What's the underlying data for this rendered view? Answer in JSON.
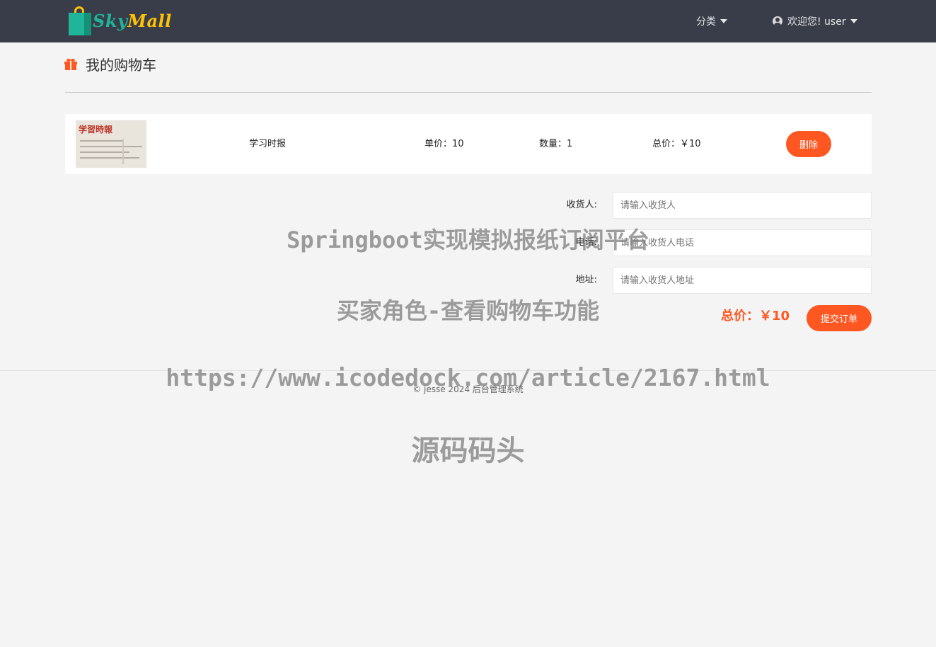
{
  "header": {
    "logo": {
      "part1": "Sky",
      "part2": "Mall"
    },
    "category_menu": "分类",
    "user_menu": "欢迎您! user"
  },
  "page": {
    "title": "我的购物车"
  },
  "cart": {
    "items": [
      {
        "name": "学习时报",
        "unit_price": "单价：10",
        "quantity": "数量：1",
        "total": "总价：￥10",
        "delete_label": "删除",
        "thumb_title": "学習時報"
      }
    ]
  },
  "form": {
    "receiver_label": "收货人:",
    "receiver_placeholder": "请输入收货人",
    "phone_label": "电话:",
    "phone_placeholder": "请输入收货人电话",
    "address_label": "地址:",
    "address_placeholder": "请输入收货人地址"
  },
  "summary": {
    "total": "总价：￥10",
    "submit_label": "提交订单"
  },
  "footer": {
    "text": "© jesse 2024 后台管理系统"
  },
  "watermark": {
    "line1": "Springboot实现模拟报纸订阅平台",
    "line2": "买家角色-查看购物车功能",
    "line3": "https://www.icodedock.com/article/2167.html",
    "line4": "源码码头"
  },
  "colors": {
    "navbar": "#393d49",
    "accent": "#ff5722",
    "logo_green": "#1fb59a",
    "logo_yellow": "#ffc107",
    "page_bg": "#f4f4f4"
  }
}
